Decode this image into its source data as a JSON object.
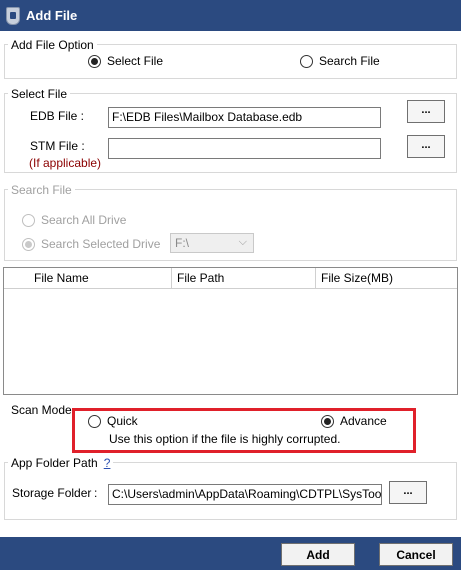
{
  "window": {
    "title": "Add File"
  },
  "add_file_option": {
    "title": "Add File Option",
    "options": [
      "Select File",
      "Search File"
    ],
    "selected": "Select File"
  },
  "select_file": {
    "title": "Select File",
    "edb_label": "EDB File :",
    "edb_value": "F:\\EDB Files\\Mailbox Database.edb",
    "stm_label": "STM File :",
    "stm_hint": "(If applicable)",
    "stm_value": "",
    "browse_label": "..."
  },
  "search_file": {
    "title": "Search File",
    "options": [
      "Search All Drive",
      "Search Selected Drive"
    ],
    "selected": "Search Selected Drive",
    "drive_value": "F:\\"
  },
  "file_table": {
    "columns": [
      "File Name",
      "File Path",
      "File Size(MB)"
    ],
    "rows": []
  },
  "scan_mode": {
    "title": "Scan Mode",
    "options": [
      "Quick",
      "Advance"
    ],
    "selected": "Advance",
    "description": "Use this option if the file is highly corrupted."
  },
  "app_folder": {
    "title": "App Folder Path",
    "help": "?",
    "storage_label": "Storage Folder",
    "colon": ":",
    "storage_value": "C:\\Users\\admin\\AppData\\Roaming\\CDTPL\\SysTools E",
    "browse_label": "..."
  },
  "footer": {
    "add_label": "Add",
    "cancel_label": "Cancel"
  },
  "colors": {
    "titlebar": "#2b4a80",
    "highlight": "#e0202a",
    "hint": "#8b0000"
  }
}
